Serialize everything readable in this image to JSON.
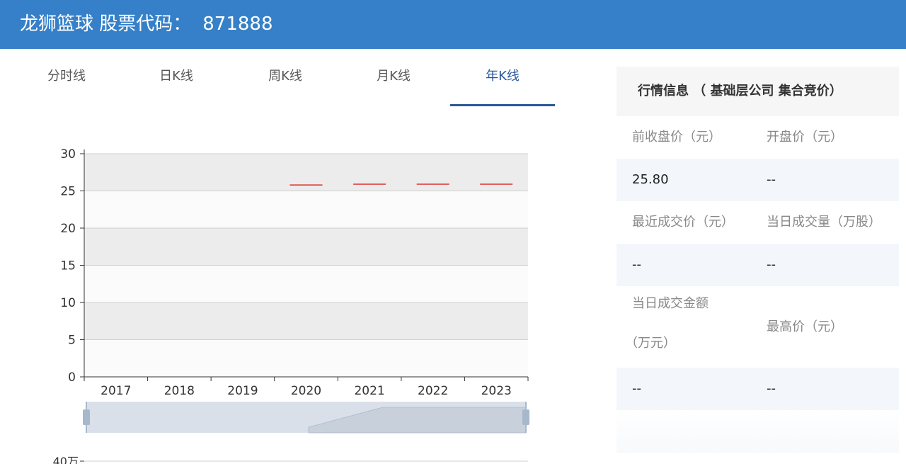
{
  "header": {
    "name": "龙狮篮球 股票代码：",
    "code": "871888"
  },
  "tabs": [
    {
      "label": "分时线",
      "active": false
    },
    {
      "label": "日K线",
      "active": false
    },
    {
      "label": "周K线",
      "active": false
    },
    {
      "label": "月K线",
      "active": false
    },
    {
      "label": "年K线",
      "active": true
    }
  ],
  "chart_data": {
    "type": "candlestick",
    "categories": [
      "2017",
      "2018",
      "2019",
      "2020",
      "2021",
      "2022",
      "2023"
    ],
    "series": [
      {
        "values": [
          null,
          null,
          null,
          25.8,
          25.9,
          25.9,
          25.9
        ]
      }
    ],
    "y_ticks": [
      "30",
      "25",
      "20",
      "15",
      "10",
      "5",
      "0"
    ],
    "ylim": [
      0,
      30
    ],
    "line_color": "#e03030",
    "grid": true,
    "band_colors": [
      "#ececec",
      "#fbfbfb"
    ],
    "volume_top_label": "40万"
  },
  "panel": {
    "title": "行情信息 （ 基础层公司 集合竞价）",
    "rows": [
      {
        "k1": "前收盘价（元）",
        "k2": "开盘价（元）",
        "v1": "25.80",
        "v2": "--"
      },
      {
        "k1": "最近成交价（元）",
        "k2": "当日成交量（万股）",
        "v1": "--",
        "v2": "--"
      },
      {
        "k1a": "当日成交金额",
        "k1b": "（万元）",
        "k2": "最高价（元）",
        "v1": "--",
        "v2": "--"
      }
    ]
  }
}
